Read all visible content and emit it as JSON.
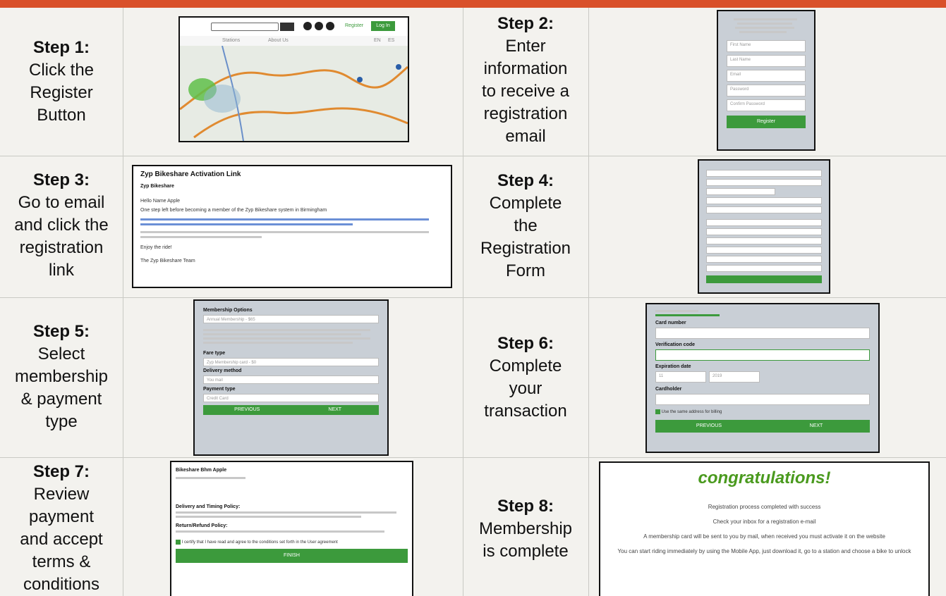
{
  "colors": {
    "accent": "#d9502a",
    "green": "#3c9a3c",
    "congrats": "#4a9a1e"
  },
  "steps": [
    {
      "title": "Step 1:",
      "desc": [
        "Click the",
        "Register",
        "Button"
      ]
    },
    {
      "title": "Step 2:",
      "desc": [
        "Enter",
        "information",
        "to receive a",
        "registration",
        "email"
      ]
    },
    {
      "title": "Step 3:",
      "desc": [
        "Go to email",
        "and click the",
        "registration",
        "link"
      ]
    },
    {
      "title": "Step 4:",
      "desc": [
        "Complete",
        "the",
        "Registration",
        "Form"
      ]
    },
    {
      "title": "Step 5:",
      "desc": [
        "Select",
        "membership",
        "& payment",
        "type"
      ]
    },
    {
      "title": "Step 6:",
      "desc": [
        "Complete",
        "your",
        "transaction"
      ]
    },
    {
      "title": "Step 7:",
      "desc": [
        "Review",
        "payment",
        "and accept",
        "terms &",
        "conditions"
      ]
    },
    {
      "title": "Step 8:",
      "desc": [
        "Membership",
        "is complete"
      ]
    }
  ],
  "shot1": {
    "register": "Register",
    "login": "Log In",
    "tabs": [
      "Stations",
      "About Us"
    ],
    "lang": [
      "EN",
      "ES"
    ]
  },
  "shot2": {
    "fields": [
      "First Name",
      "Last Name",
      "Email",
      "Password",
      "Confirm Password"
    ],
    "button": "Register"
  },
  "shot3": {
    "subject": "Zyp Bikeshare Activation Link",
    "sender": "Zyp Bikeshare",
    "greeting": "Hello Name Apple",
    "body": "One step left before becoming a member of the Zyp Bikeshare system in Birmingham",
    "signoff": "Enjoy the ride!",
    "team": "The Zyp Bikeshare Team"
  },
  "shot5": {
    "label1": "Membership Options",
    "value1": "Annual Membership - $65",
    "label2": "Fare type",
    "value2": "Zyp Membership card - $0",
    "label3": "Delivery method",
    "value3": "You mail",
    "label4": "Payment type",
    "value4": "Credit Card",
    "prev": "PREVIOUS",
    "next": "NEXT"
  },
  "shot6": {
    "label1": "Card number",
    "label2": "Verification code",
    "label3": "Expiration date",
    "month": "11",
    "year": "2019",
    "label4": "Cardholder",
    "check": "Use the same address for billing",
    "prev": "PREVIOUS",
    "next": "NEXT"
  },
  "shot7": {
    "name": "Bikeshare Bhm Apple",
    "policy1": "Delivery and Timing Policy:",
    "policy2": "Return/Refund Policy:",
    "terms": "I certify that I have read and agree to the conditions set forth in the User agreement",
    "finish": "FINISH"
  },
  "shot8": {
    "title": "congratulations!",
    "lines": [
      "Registration process completed with success",
      "Check your inbox for a registration e-mail",
      "A membership card will be sent to you by mail, when received you must activate it on the website",
      "You can start riding immediately by using the Mobile App, just download it, go to a station and choose a bike to unlock"
    ]
  }
}
